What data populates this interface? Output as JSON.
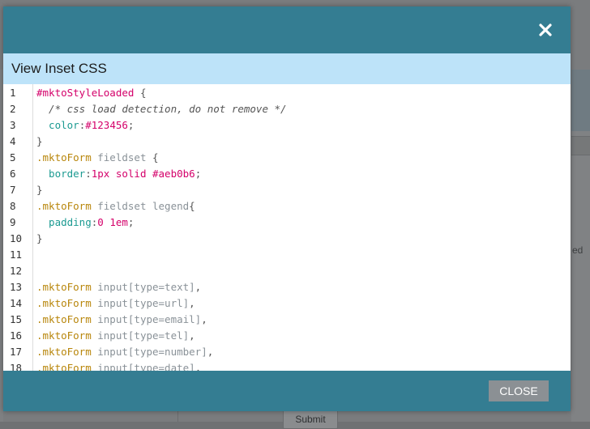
{
  "background": {
    "right_text": "ed",
    "submit_label": "Submit"
  },
  "modal": {
    "title": "View Inset CSS",
    "close_button_label": "CLOSE",
    "colors": {
      "header": "#347d92",
      "title_bar": "#bde3f9",
      "button": "#8b9094"
    }
  },
  "code_lines": [
    {
      "n": "1",
      "tokens": [
        [
          "sel",
          "#mktoStyleLoaded"
        ],
        [
          "pun",
          " {"
        ]
      ]
    },
    {
      "n": "2",
      "tokens": [
        [
          "com",
          "  /* css load detection, do not remove */"
        ]
      ]
    },
    {
      "n": "3",
      "tokens": [
        [
          "prop",
          "  color"
        ],
        [
          "pun",
          ":"
        ],
        [
          "val",
          "#123456"
        ],
        [
          "pun",
          ";"
        ]
      ]
    },
    {
      "n": "4",
      "tokens": [
        [
          "pun",
          "}"
        ]
      ]
    },
    {
      "n": "5",
      "tokens": [
        [
          "cls",
          ".mktoForm"
        ],
        [
          "tag",
          " fieldset"
        ],
        [
          "pun",
          " {"
        ]
      ]
    },
    {
      "n": "6",
      "tokens": [
        [
          "prop",
          "  border"
        ],
        [
          "pun",
          ":"
        ],
        [
          "val",
          "1px solid #aeb0b6"
        ],
        [
          "pun",
          ";"
        ]
      ]
    },
    {
      "n": "7",
      "tokens": [
        [
          "pun",
          "}"
        ]
      ]
    },
    {
      "n": "8",
      "tokens": [
        [
          "cls",
          ".mktoForm"
        ],
        [
          "tag",
          " fieldset legend"
        ],
        [
          "pun",
          "{"
        ]
      ]
    },
    {
      "n": "9",
      "tokens": [
        [
          "prop",
          "  padding"
        ],
        [
          "pun",
          ":"
        ],
        [
          "val",
          "0 1em"
        ],
        [
          "pun",
          ";"
        ]
      ]
    },
    {
      "n": "10",
      "tokens": [
        [
          "pun",
          "}"
        ]
      ]
    },
    {
      "n": "11",
      "tokens": []
    },
    {
      "n": "12",
      "tokens": []
    },
    {
      "n": "13",
      "tokens": [
        [
          "cls",
          ".mktoForm"
        ],
        [
          "tag",
          " input[type=text]"
        ],
        [
          "pun",
          ","
        ]
      ]
    },
    {
      "n": "14",
      "tokens": [
        [
          "cls",
          ".mktoForm"
        ],
        [
          "tag",
          " input[type=url]"
        ],
        [
          "pun",
          ","
        ]
      ]
    },
    {
      "n": "15",
      "tokens": [
        [
          "cls",
          ".mktoForm"
        ],
        [
          "tag",
          " input[type=email]"
        ],
        [
          "pun",
          ","
        ]
      ]
    },
    {
      "n": "16",
      "tokens": [
        [
          "cls",
          ".mktoForm"
        ],
        [
          "tag",
          " input[type=tel]"
        ],
        [
          "pun",
          ","
        ]
      ]
    },
    {
      "n": "17",
      "tokens": [
        [
          "cls",
          ".mktoForm"
        ],
        [
          "tag",
          " input[type=number]"
        ],
        [
          "pun",
          ","
        ]
      ]
    },
    {
      "n": "18",
      "tokens": [
        [
          "cls",
          ".mktoForm"
        ],
        [
          "tag",
          " input[type=date]"
        ],
        [
          "pun",
          ","
        ]
      ]
    }
  ]
}
